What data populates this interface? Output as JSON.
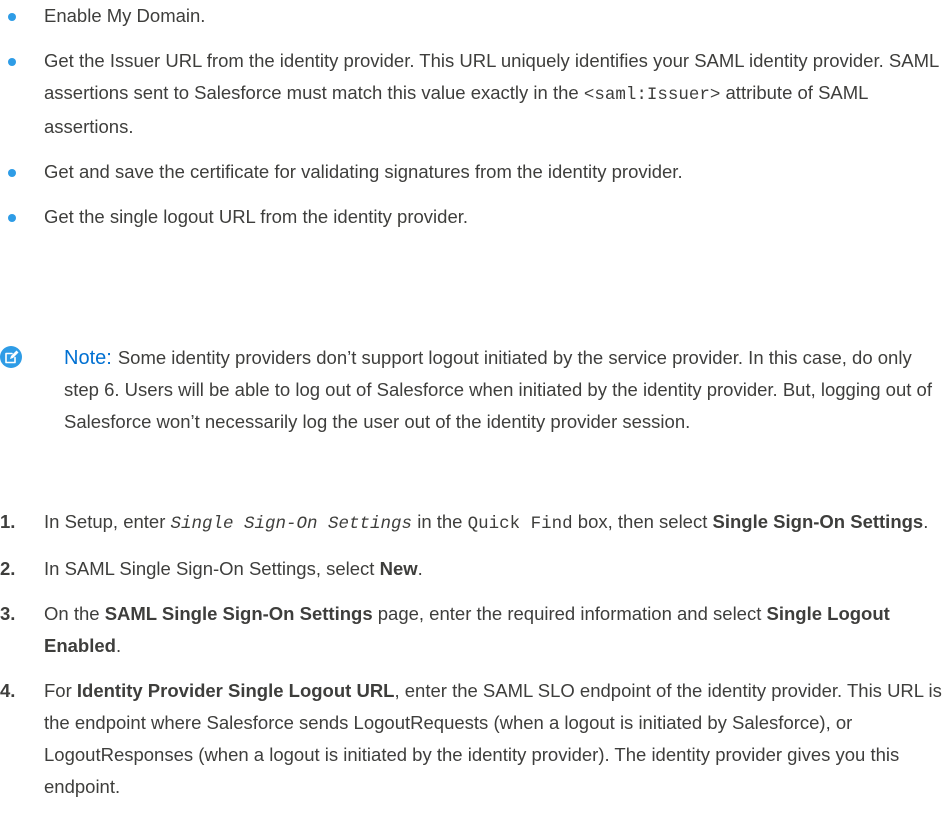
{
  "bullets": [
    {
      "text": "Enable My Domain."
    },
    {
      "text_before": "Get the Issuer URL from the identity provider. This URL uniquely identifies your SAML identity provider. SAML assertions sent to Salesforce must match this value exactly in the ",
      "code": "<saml:Issuer>",
      "text_after": " attribute of SAML assertions."
    },
    {
      "text": "Get and save the certificate for validating signatures from the identity provider."
    },
    {
      "text": "Get the single logout URL from the identity provider."
    }
  ],
  "note": {
    "label": "Note:",
    "text": "Some identity providers don’t support logout initiated by the service provider. In this case, do only step 6. Users will be able to log out of Salesforce when initiated by the identity provider. But, logging out of Salesforce won’t necessarily log the user out of the identity provider session."
  },
  "steps": [
    {
      "num": "1.",
      "t1": "In Setup, enter ",
      "code1": "Single Sign-On Settings",
      "t2": " in the ",
      "code2": "Quick Find",
      "t3": " box, then select ",
      "bold1": "Single Sign-On Settings",
      "t4": "."
    },
    {
      "num": "2.",
      "t1": "In SAML Single Sign-On Settings, select ",
      "bold1": "New",
      "t2": "."
    },
    {
      "num": "3.",
      "t1": "On the ",
      "bold1": "SAML Single Sign-On Settings",
      "t2": " page, enter the required information and select ",
      "bold2": "Single Logout Enabled",
      "t3": "."
    },
    {
      "num": "4.",
      "t1": "For ",
      "bold1": "Identity Provider Single Logout URL",
      "t2": ", enter the SAML SLO endpoint of the identity provider. This URL is the endpoint where Salesforce sends LogoutRequests (when a logout is initiated by Salesforce), or LogoutResponses (when a logout is initiated by the identity provider). The identity provider gives you this endpoint."
    }
  ],
  "colors": {
    "bullet": "#2e9ce6",
    "note_accent": "#0070d2",
    "text": "#3e3e3c"
  }
}
